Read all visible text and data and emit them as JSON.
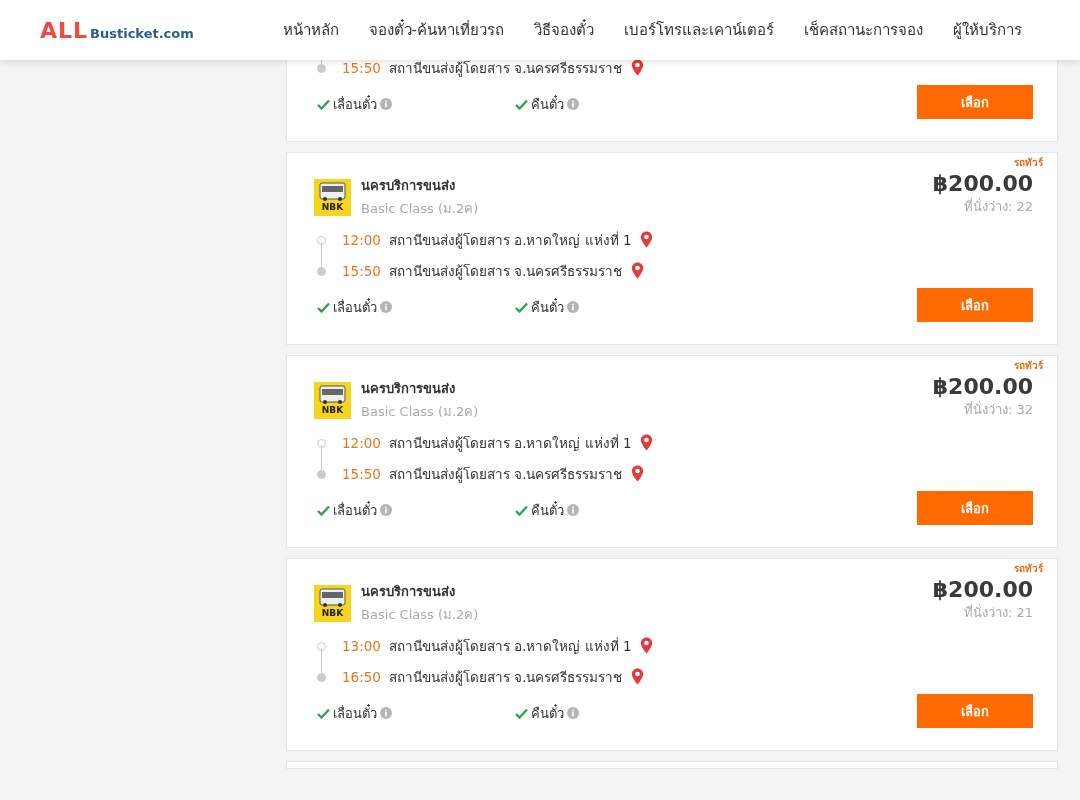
{
  "header": {
    "logo": {
      "accent": "ALL",
      "rest": "Busticket.com"
    },
    "nav": [
      "หน้าหลัก",
      "จองตั๋ว-ค้นหาเที่ยวรถ",
      "วิธีจองตั๋ว",
      "เบอร์โทรและเคาน์เตอร์",
      "เช็คสถานะการจอง",
      "ผู้ให้บริการ"
    ]
  },
  "trips": [
    {
      "kind": "partial",
      "stops": [
        {
          "kind": "destination",
          "time": "15:50",
          "place": "สถานีขนส่งผู้โดยสาร จ.นครศรีธรรมราช"
        }
      ],
      "options": [
        {
          "label": "เลื่อนตั๋ว",
          "available": true
        },
        {
          "label": "คืนตั๋ว",
          "available": true
        }
      ],
      "button": "เลือก"
    },
    {
      "kind": "full",
      "badge": "รถทัวร์",
      "logo_text": "NBK",
      "operator": "นครบริการขนส่ง",
      "bus_class": "Basic Class (ม.2ค)",
      "price": "฿200.00",
      "seats": "ที่นั่งว่าง: 22",
      "stops": [
        {
          "kind": "origin",
          "time": "12:00",
          "place": "สถานีขนส่งผู้โดยสาร อ.หาดใหญ่ แห่งที่ 1"
        },
        {
          "kind": "destination",
          "time": "15:50",
          "place": "สถานีขนส่งผู้โดยสาร จ.นครศรีธรรมราช"
        }
      ],
      "options": [
        {
          "label": "เลื่อนตั๋ว",
          "available": true
        },
        {
          "label": "คืนตั๋ว",
          "available": true
        }
      ],
      "button": "เลือก"
    },
    {
      "kind": "full",
      "badge": "รถทัวร์",
      "logo_text": "NBK",
      "operator": "นครบริการขนส่ง",
      "bus_class": "Basic Class (ม.2ค)",
      "price": "฿200.00",
      "seats": "ที่นั่งว่าง: 32",
      "stops": [
        {
          "kind": "origin",
          "time": "12:00",
          "place": "สถานีขนส่งผู้โดยสาร อ.หาดใหญ่ แห่งที่ 1"
        },
        {
          "kind": "destination",
          "time": "15:50",
          "place": "สถานีขนส่งผู้โดยสาร จ.นครศรีธรรมราช"
        }
      ],
      "options": [
        {
          "label": "เลื่อนตั๋ว",
          "available": true
        },
        {
          "label": "คืนตั๋ว",
          "available": true
        }
      ],
      "button": "เลือก"
    },
    {
      "kind": "full",
      "badge": "รถทัวร์",
      "logo_text": "NBK",
      "operator": "นครบริการขนส่ง",
      "bus_class": "Basic Class (ม.2ค)",
      "price": "฿200.00",
      "seats": "ที่นั่งว่าง: 21",
      "stops": [
        {
          "kind": "origin",
          "time": "13:00",
          "place": "สถานีขนส่งผู้โดยสาร อ.หาดใหญ่ แห่งที่ 1"
        },
        {
          "kind": "destination",
          "time": "16:50",
          "place": "สถานีขนส่งผู้โดยสาร จ.นครศรีธรรมราช"
        }
      ],
      "options": [
        {
          "label": "เลื่อนตั๋ว",
          "available": true
        },
        {
          "label": "คืนตั๋ว",
          "available": true
        }
      ],
      "button": "เลือก"
    },
    {
      "kind": "edge"
    }
  ]
}
